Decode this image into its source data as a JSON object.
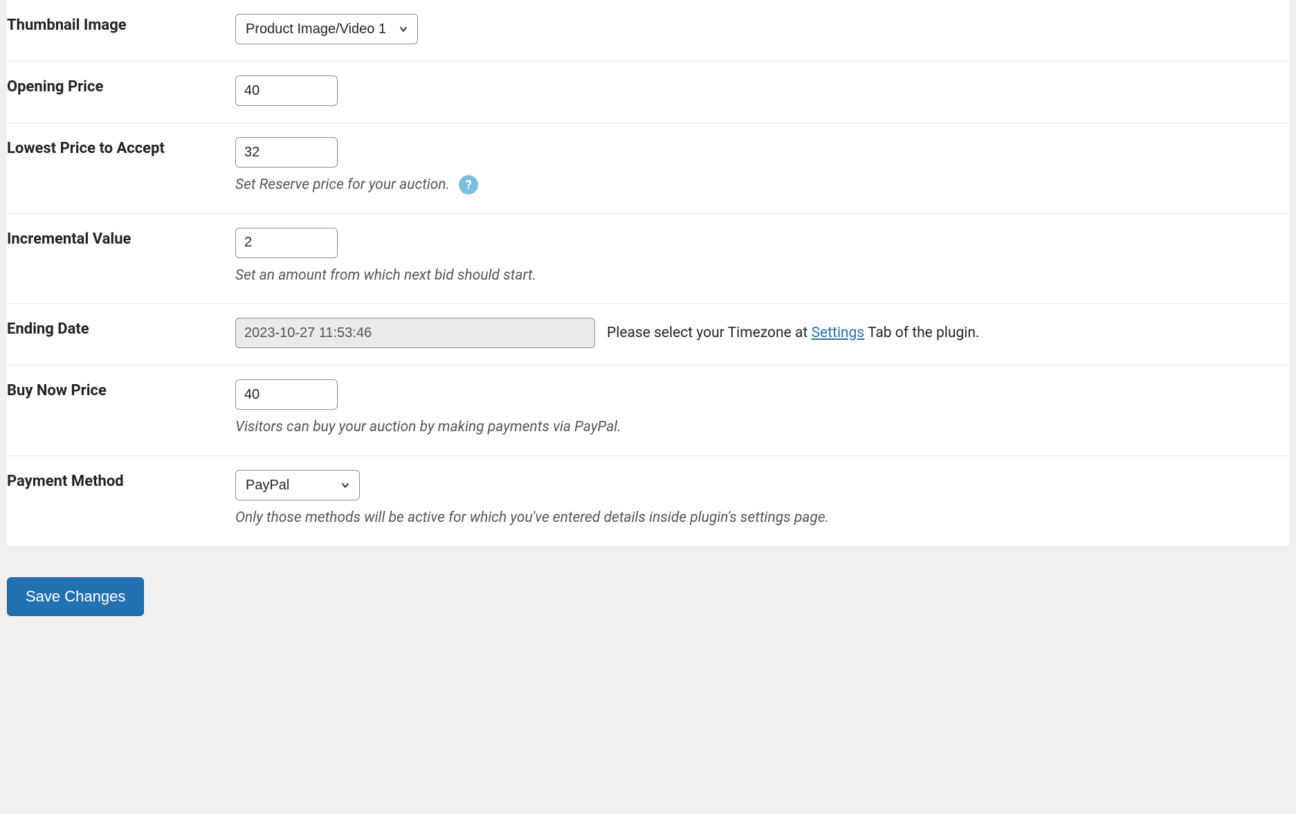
{
  "fields": {
    "thumbnail": {
      "label": "Thumbnail Image",
      "selected": "Product Image/Video 1"
    },
    "opening_price": {
      "label": "Opening Price",
      "value": "40"
    },
    "lowest_price": {
      "label": "Lowest Price to Accept",
      "value": "32",
      "desc": "Set Reserve price for your auction."
    },
    "incremental_value": {
      "label": "Incremental Value",
      "value": "2",
      "desc": "Set an amount from which next bid should start."
    },
    "ending_date": {
      "label": "Ending Date",
      "value": "2023-10-27 11:53:46",
      "desc_prefix": "Please select your Timezone at ",
      "link_text": "Settings",
      "desc_suffix": " Tab of the plugin."
    },
    "buy_now": {
      "label": "Buy Now Price",
      "value": "40",
      "desc": "Visitors can buy your auction by making payments via PayPal."
    },
    "payment_method": {
      "label": "Payment Method",
      "selected": "PayPal",
      "desc": "Only those methods will be active for which you've entered details inside plugin's settings page."
    }
  },
  "button": {
    "save_label": "Save Changes"
  }
}
